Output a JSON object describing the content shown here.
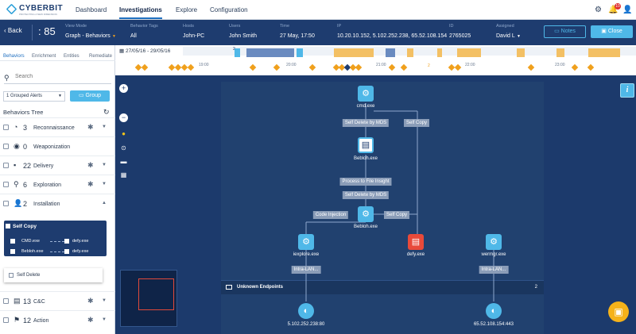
{
  "brand": {
    "name": "CYBERBIT",
    "tagline": "PROTECTING A NEW DIMENSION"
  },
  "nav": {
    "tabs": [
      "Dashboard",
      "Investigations",
      "Explore",
      "Configuration"
    ],
    "active": "Investigations",
    "notification_count": "10"
  },
  "infobar": {
    "back": "Back",
    "case_number": "85",
    "view_mode_label": "View Mode",
    "view_mode_value": "Graph - Behaviors",
    "tags_label": "Behavior Tags",
    "tags_value": "All",
    "hosts_label": "Hosts",
    "hosts_value": "John-PC",
    "users_label": "Users",
    "users_value": "John Smith",
    "time_label": "Time",
    "time_value": "27 May, 17:50",
    "ip_label": "IP",
    "ip_value": "10.20.10.152, 5.102.252.238, 65.52.108.154",
    "id_label": "ID",
    "id_value": "2765025",
    "assigned_label": "Assigned",
    "assigned_value": "David L",
    "notes": "Notes",
    "close": "Close"
  },
  "sidebar": {
    "tabs": [
      "Behaviors",
      "Enrichment",
      "Entities",
      "Remediate"
    ],
    "search_placeholder": "Search",
    "group_select": "1 Grouped Alerts",
    "group_button": "Group",
    "tree_header": "Behaviors Tree",
    "items": [
      {
        "count": "3",
        "label": "Reconnaissance",
        "icon": "gauge-icon"
      },
      {
        "count": "0",
        "label": "Weaponization",
        "icon": "target-icon"
      },
      {
        "count": "22",
        "label": "Delivery",
        "icon": "box-icon"
      },
      {
        "count": "6",
        "label": "Exploration",
        "icon": "magnifier-icon"
      },
      {
        "count": "2",
        "label": "Installation",
        "icon": "user-icon"
      },
      {
        "count": "13",
        "label": "C&C",
        "icon": "server-icon"
      },
      {
        "count": "12",
        "label": "Action",
        "icon": "flag-icon"
      }
    ],
    "self_copy": {
      "title": "Self Copy",
      "rows": [
        [
          "CMD.exe",
          "defy.exe"
        ],
        [
          "Bebloh.exe",
          "defy.exe"
        ]
      ]
    },
    "self_delete": "Self Delete"
  },
  "timeline": {
    "range": "27/05/16 - 29/05/16",
    "ticks": [
      "19:00",
      "20:00",
      "21:00",
      "22:00",
      "23:00"
    ],
    "markers": [
      "2",
      "2"
    ]
  },
  "graph": {
    "nodes": {
      "cmd": "cmd.exe",
      "bebloh1": "Bebloh.exe",
      "bebloh2": "Bebloh.exe",
      "iexplore": "iexplore.exe",
      "defy": "defy.exe",
      "wermgr": "wermgr.exe",
      "ip1": "5.102.252.238:80",
      "ip2": "65.52.108.154:443"
    },
    "edges": {
      "self_delete_1": "Self Delete by MDS",
      "self_copy_1": "Self Copy",
      "process_to_file": "Process to File Insight",
      "self_delete_2": "Self Delete by MDS",
      "code_injection": "Code Injection",
      "self_copy_2": "Self Copy",
      "intra_lan_1": "Intra-LAN...",
      "intra_lan_2": "Intra-LAN..."
    },
    "unknown_endpoints": "Unknown Endpoints",
    "unknown_count": "2"
  },
  "colors": {
    "accent": "#4fb8e8",
    "navy": "#1e3c6f",
    "alert": "#e84a3a",
    "timeline_marker": "#f0a01c"
  }
}
